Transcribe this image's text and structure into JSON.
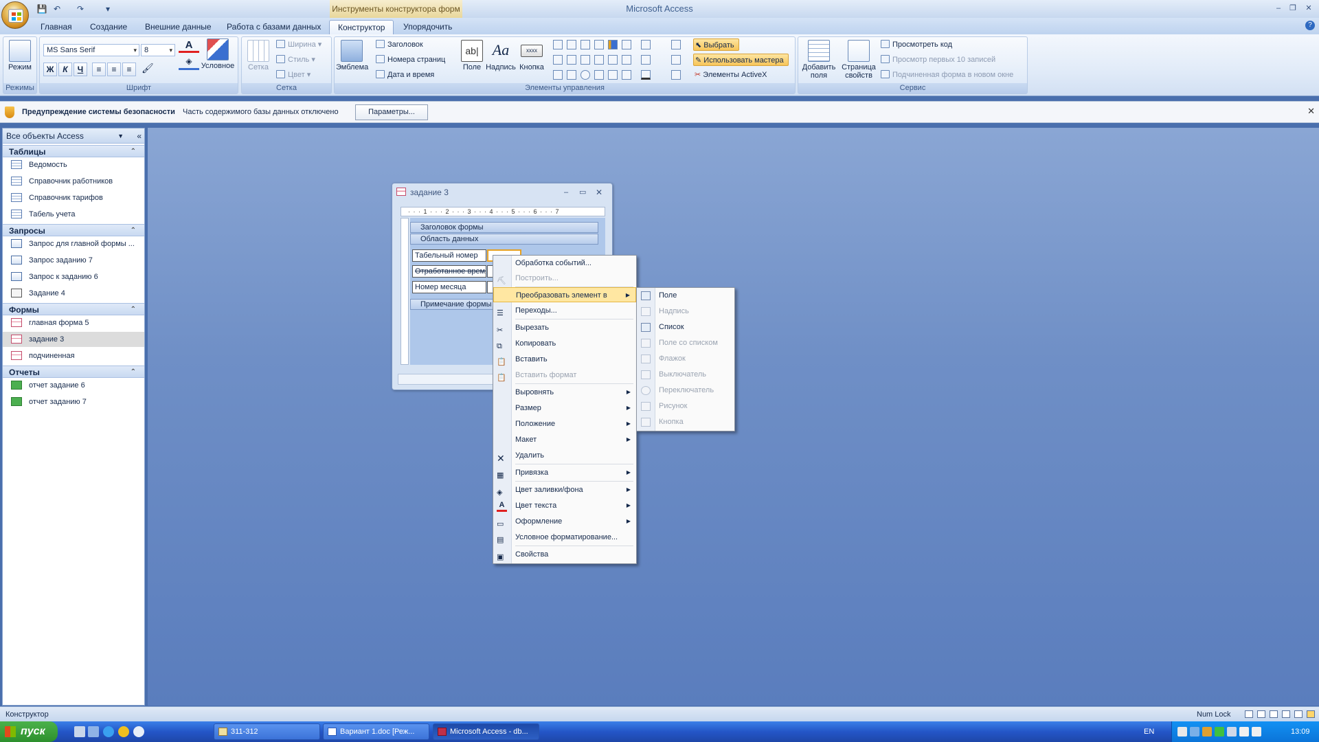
{
  "window": {
    "app_title": "Microsoft Access",
    "context_title": "Инструменты конструктора форм"
  },
  "tabs": [
    "Главная",
    "Создание",
    "Внешние данные",
    "Работа с базами данных",
    "Конструктор",
    "Упорядочить"
  ],
  "active_tab": "Конструктор",
  "ribbon": {
    "groups": {
      "views": "Режимы",
      "font": "Шрифт",
      "grid": "Сетка",
      "controls": "Элементы управления",
      "tools": "Сервис"
    },
    "mode_label": "Режим",
    "font_name": "MS Sans Serif",
    "font_size": "8",
    "conditional_label": "Условное",
    "grid_label": "Сетка",
    "width_label": "Ширина",
    "style_label": "Стиль",
    "color_label": "Цвет",
    "logo_label": "Эмблема",
    "header_label": "Заголовок",
    "page_numbers_label": "Номера страниц",
    "date_time_label": "Дата и время",
    "field_label": "Поле",
    "caption_label": "Надпись",
    "button_label": "Кнопка",
    "select_label": "Выбрать",
    "wizards_label": "Использовать мастера",
    "activex_label": "Элементы ActiveX",
    "add_field_label_1": "Добавить",
    "add_field_label_2": "поля",
    "property_sheet_label_1": "Страница",
    "property_sheet_label_2": "свойств",
    "view_code_label": "Просмотреть код",
    "view_top10_label": "Просмотр первых 10 записей",
    "subform_window_label": "Подчиненная форма в новом окне",
    "bold": "Ж",
    "italic": "К",
    "underline": "Ч"
  },
  "security_bar": {
    "title": "Предупреждение системы безопасности",
    "message": "Часть содержимого базы данных отключено",
    "button": "Параметры..."
  },
  "nav_pane": {
    "header": "Все объекты Access",
    "sections": [
      {
        "title": "Таблицы",
        "items": [
          "Ведомость",
          "Справочник работников",
          "Справочник тарифов",
          "Табель учета"
        ]
      },
      {
        "title": "Запросы",
        "items": [
          "Запрос для главной формы ...",
          "Запрос заданию 7",
          "Запрос к заданию 6",
          "Задание 4"
        ]
      },
      {
        "title": "Формы",
        "items": [
          "главная форма 5",
          "задание 3",
          "подчиненная"
        ]
      },
      {
        "title": "Отчеты",
        "items": [
          "отчет задание 6",
          "отчет заданию 7"
        ]
      }
    ]
  },
  "form_window": {
    "title": "задание 3",
    "ruler": "· · · 1 · · · 2 · · · 3 · · · 4 · · · 5 · · · 6 · · · 7",
    "header_section": "Заголовок формы",
    "detail_section": "Область данных",
    "footer_section": "Примечание формы",
    "controls": [
      "Табельный номер",
      "Отработанное время",
      "Номер месяца"
    ]
  },
  "context_menu": {
    "items": [
      {
        "label": "Обработка событий...",
        "disabled": false
      },
      {
        "label": "Построить...",
        "disabled": true
      },
      {
        "label": "Преобразовать элемент в",
        "disabled": false
      },
      {
        "label": "Переходы...",
        "disabled": false
      },
      {
        "label": "Вырезать",
        "disabled": false
      },
      {
        "label": "Копировать",
        "disabled": false
      },
      {
        "label": "Вставить",
        "disabled": false
      },
      {
        "label": "Вставить формат",
        "disabled": true
      },
      {
        "label": "Выровнять",
        "disabled": false
      },
      {
        "label": "Размер",
        "disabled": false
      },
      {
        "label": "Положение",
        "disabled": false
      },
      {
        "label": "Макет",
        "disabled": false
      },
      {
        "label": "Удалить",
        "disabled": false
      },
      {
        "label": "Привязка",
        "disabled": false
      },
      {
        "label": "Цвет заливки/фона",
        "disabled": false
      },
      {
        "label": "Цвет текста",
        "disabled": false
      },
      {
        "label": "Оформление",
        "disabled": false
      },
      {
        "label": "Условное форматирование...",
        "disabled": false
      },
      {
        "label": "Свойства",
        "disabled": false
      }
    ]
  },
  "submenu": {
    "items": [
      {
        "label": "Поле",
        "disabled": false
      },
      {
        "label": "Надпись",
        "disabled": true
      },
      {
        "label": "Список",
        "disabled": false
      },
      {
        "label": "Поле со списком",
        "disabled": true
      },
      {
        "label": "Флажок",
        "disabled": true
      },
      {
        "label": "Выключатель",
        "disabled": true
      },
      {
        "label": "Переключатель",
        "disabled": true
      },
      {
        "label": "Рисунок",
        "disabled": true
      },
      {
        "label": "Кнопка",
        "disabled": true
      }
    ]
  },
  "status_bar": {
    "mode": "Конструктор",
    "num_lock": "Num Lock"
  },
  "taskbar": {
    "start": "пуск",
    "tasks": [
      "311-312",
      "Вариант 1.doc [Реж...",
      "Microsoft Access - db..."
    ],
    "lang": "EN",
    "time": "13:09"
  },
  "colors": {
    "accent": "#2456c7",
    "workspace": "#6f8fc6",
    "highlight": "#ffe7a2"
  }
}
